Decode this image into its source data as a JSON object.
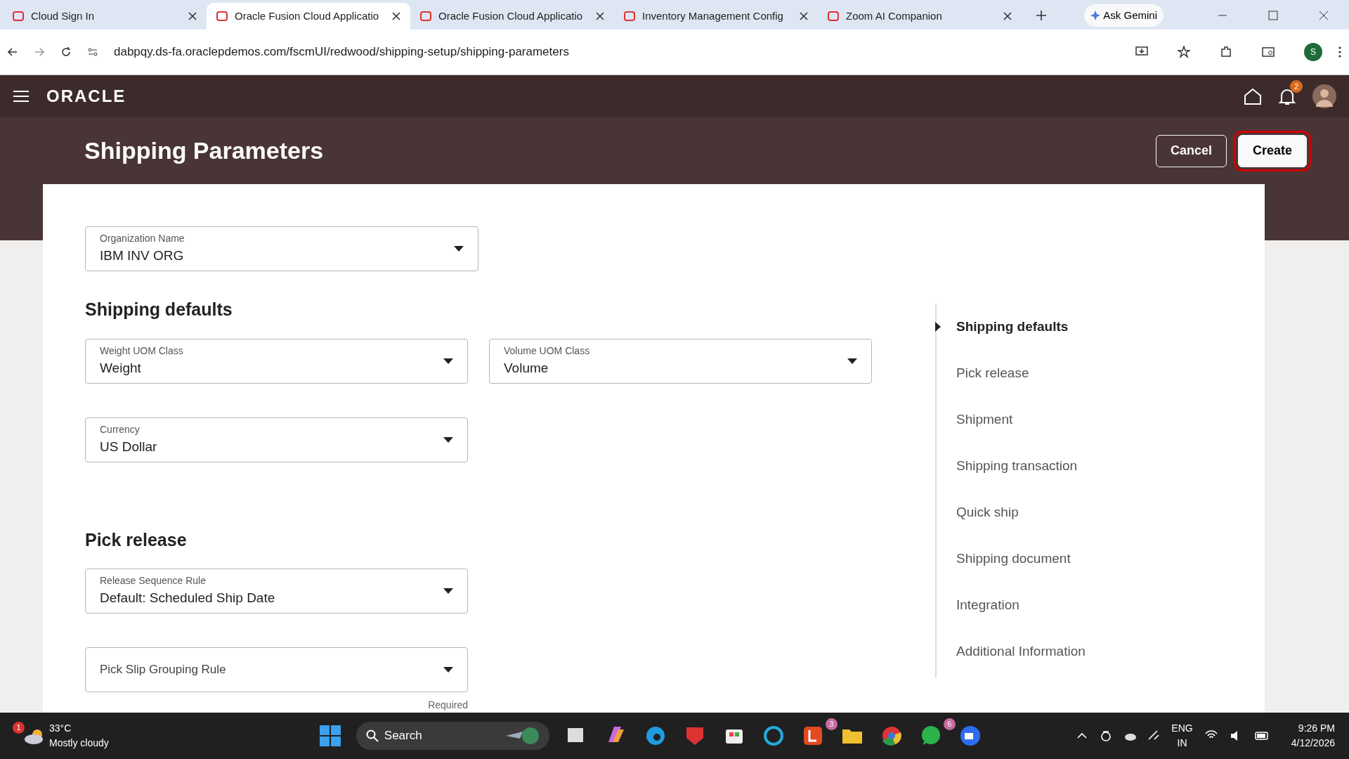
{
  "browser": {
    "tabs": [
      {
        "title": "Cloud Sign In",
        "selected": false
      },
      {
        "title": "Oracle Fusion Cloud Applicatio",
        "selected": true
      },
      {
        "title": "Oracle Fusion Cloud Applicatio",
        "selected": false
      },
      {
        "title": "Inventory Management Config",
        "selected": false
      },
      {
        "title": "Zoom AI Companion",
        "selected": false
      }
    ],
    "gemini": "Ask Gemini",
    "url": "dabpqy.ds-fa.oraclepdemos.com/fscmUI/redwood/shipping-setup/shipping-parameters",
    "profile": "S"
  },
  "app": {
    "brand": "ORACLE",
    "notifications": "2",
    "title": "Shipping Parameters",
    "buttons": [
      {
        "label": "Cancel",
        "kind": "outline",
        "highlighted": false
      },
      {
        "label": "Create",
        "kind": "solid",
        "highlighted": true
      }
    ]
  },
  "form": {
    "organization": {
      "label": "Organization Name",
      "value": "IBM INV ORG"
    },
    "sections": [
      {
        "heading": "Shipping defaults",
        "rows": [
          [
            {
              "label": "Weight UOM Class",
              "value": "Weight"
            },
            {
              "label": "Volume UOM Class",
              "value": "Volume"
            }
          ],
          [
            {
              "label": "Currency",
              "value": "US Dollar"
            }
          ]
        ]
      },
      {
        "heading": "Pick release",
        "rows": [
          [
            {
              "label": "Release Sequence Rule",
              "value": "Default: Scheduled Ship Date"
            }
          ],
          [
            {
              "label": "Pick Slip Grouping Rule",
              "helper": "Required"
            }
          ]
        ]
      }
    ]
  },
  "nav": [
    {
      "label": "Shipping defaults",
      "selected": true
    },
    {
      "label": "Pick release",
      "selected": false
    },
    {
      "label": "Shipment",
      "selected": false
    },
    {
      "label": "Shipping transaction",
      "selected": false
    },
    {
      "label": "Quick ship",
      "selected": false
    },
    {
      "label": "Shipping document",
      "selected": false
    },
    {
      "label": "Integration",
      "selected": false
    },
    {
      "label": "Additional Information",
      "selected": false
    }
  ],
  "taskbar": {
    "weather_badge": "1",
    "temperature": "33°C",
    "condition": "Mostly cloudy",
    "search": "Search",
    "apps": [
      {
        "kind": "files"
      },
      {
        "kind": "copilot"
      },
      {
        "kind": "edge"
      },
      {
        "kind": "shield"
      },
      {
        "kind": "store"
      },
      {
        "kind": "ring"
      },
      {
        "kind": "letter",
        "badge": "3"
      },
      {
        "kind": "folder"
      },
      {
        "kind": "chrome"
      },
      {
        "kind": "chat",
        "badge": "6"
      },
      {
        "kind": "video"
      }
    ],
    "language": "ENG",
    "region": "IN",
    "time": "9:26 PM",
    "date": "4/12/2026"
  }
}
